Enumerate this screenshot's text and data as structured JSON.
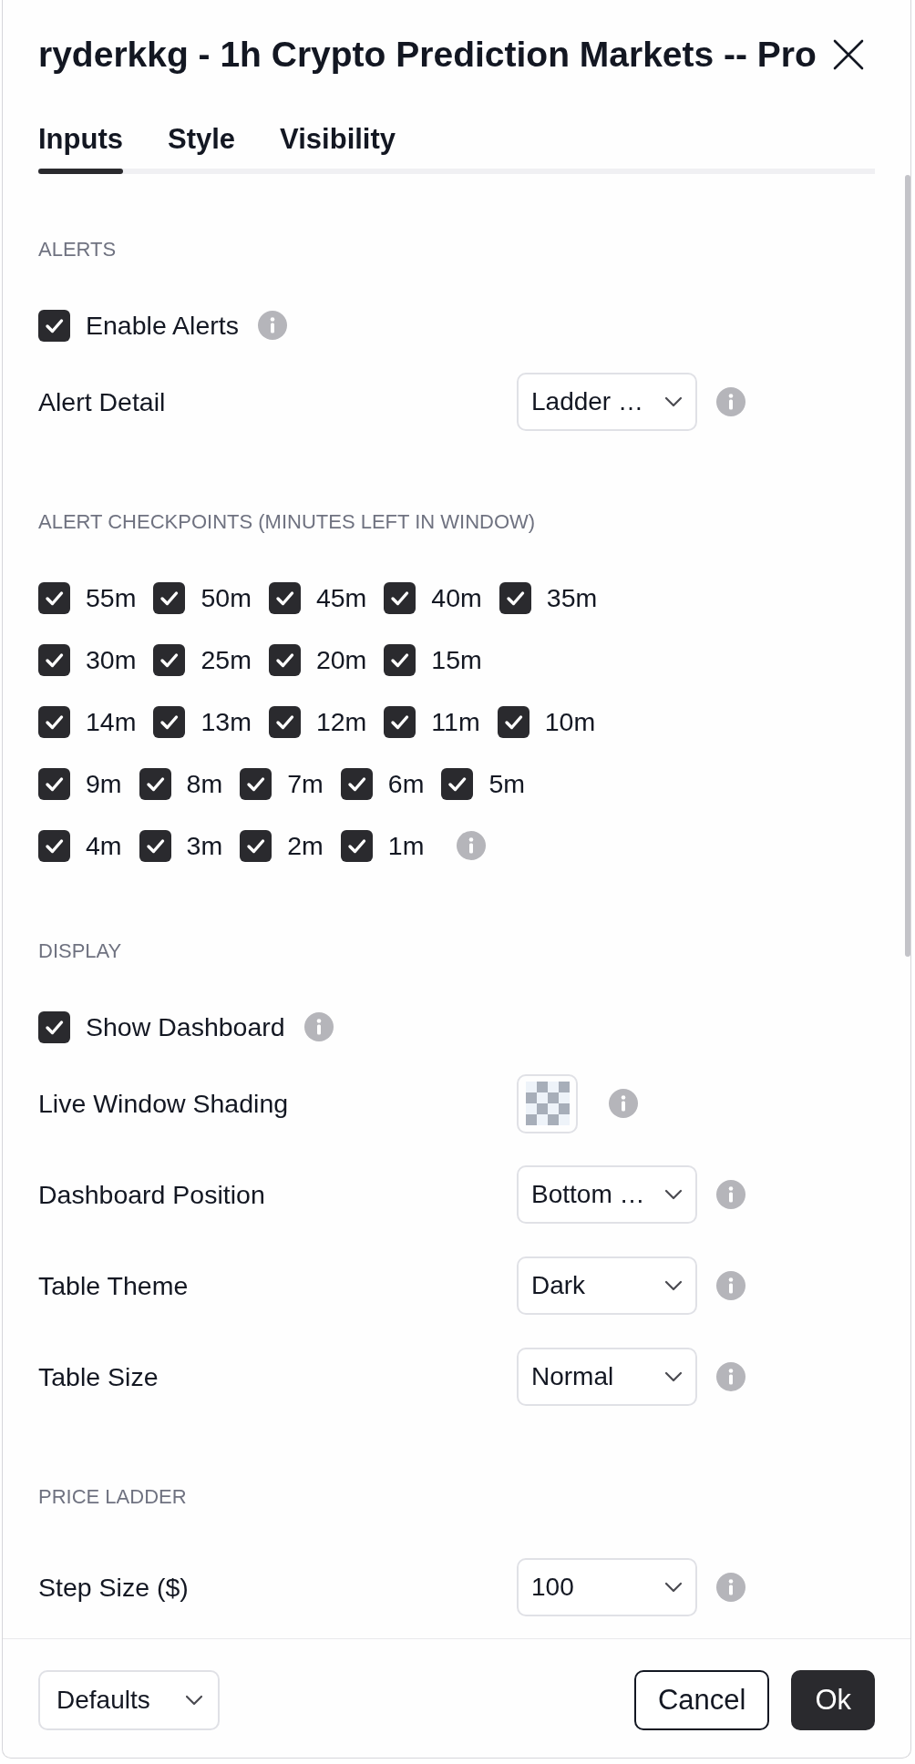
{
  "dialog": {
    "title": "ryderkkg - 1h Crypto Prediction Markets -- Pro"
  },
  "tabs": [
    {
      "label": "Inputs",
      "selected": true
    },
    {
      "label": "Style",
      "selected": false
    },
    {
      "label": "Visibility",
      "selected": false
    }
  ],
  "sections": [
    {
      "title": "ALERTS",
      "rows": [
        {
          "kind": "checkbox",
          "label": "Enable Alerts",
          "checked": true,
          "info": true
        },
        {
          "kind": "select",
          "label": "Alert Detail",
          "value": "Ladder …",
          "info": true
        }
      ]
    },
    {
      "title": "ALERT CHECKPOINTS (MINUTES LEFT IN WINDOW)",
      "rows": [
        {
          "kind": "checkbox_line",
          "info": false,
          "items": [
            {
              "label": "55m",
              "checked": true
            },
            {
              "label": "50m",
              "checked": true
            },
            {
              "label": "45m",
              "checked": true
            },
            {
              "label": "40m",
              "checked": true
            },
            {
              "label": "35m",
              "checked": true
            }
          ]
        },
        {
          "kind": "checkbox_line",
          "info": false,
          "items": [
            {
              "label": "30m",
              "checked": true
            },
            {
              "label": "25m",
              "checked": true
            },
            {
              "label": "20m",
              "checked": true
            },
            {
              "label": "15m",
              "checked": true
            }
          ]
        },
        {
          "kind": "checkbox_line",
          "info": false,
          "items": [
            {
              "label": "14m",
              "checked": true
            },
            {
              "label": "13m",
              "checked": true
            },
            {
              "label": "12m",
              "checked": true
            },
            {
              "label": "11m",
              "checked": true
            },
            {
              "label": "10m",
              "checked": true
            }
          ]
        },
        {
          "kind": "checkbox_line",
          "info": false,
          "items": [
            {
              "label": "9m",
              "checked": true
            },
            {
              "label": "8m",
              "checked": true
            },
            {
              "label": "7m",
              "checked": true
            },
            {
              "label": "6m",
              "checked": true
            },
            {
              "label": "5m",
              "checked": true
            }
          ]
        },
        {
          "kind": "checkbox_line",
          "info": true,
          "items": [
            {
              "label": "4m",
              "checked": true
            },
            {
              "label": "3m",
              "checked": true
            },
            {
              "label": "2m",
              "checked": true
            },
            {
              "label": "1m",
              "checked": true
            }
          ]
        }
      ]
    },
    {
      "title": "DISPLAY",
      "rows": [
        {
          "kind": "checkbox",
          "label": "Show Dashboard",
          "checked": true,
          "info": true
        },
        {
          "kind": "color",
          "label": "Live Window Shading",
          "info": true
        },
        {
          "kind": "select",
          "label": "Dashboard Position",
          "value": "Bottom …",
          "info": true
        },
        {
          "kind": "select",
          "label": "Table Theme",
          "value": "Dark",
          "info": true
        },
        {
          "kind": "select",
          "label": "Table Size",
          "value": "Normal",
          "info": true
        }
      ]
    },
    {
      "title": "PRICE LADDER",
      "rows": [
        {
          "kind": "select",
          "label": "Step Size ($)",
          "value": "100",
          "info": true
        }
      ]
    }
  ],
  "footer": {
    "preset": "Defaults",
    "buttons": [
      {
        "label": "Cancel",
        "kind": "cancel"
      },
      {
        "label": "Ok",
        "kind": "confirm"
      }
    ]
  }
}
